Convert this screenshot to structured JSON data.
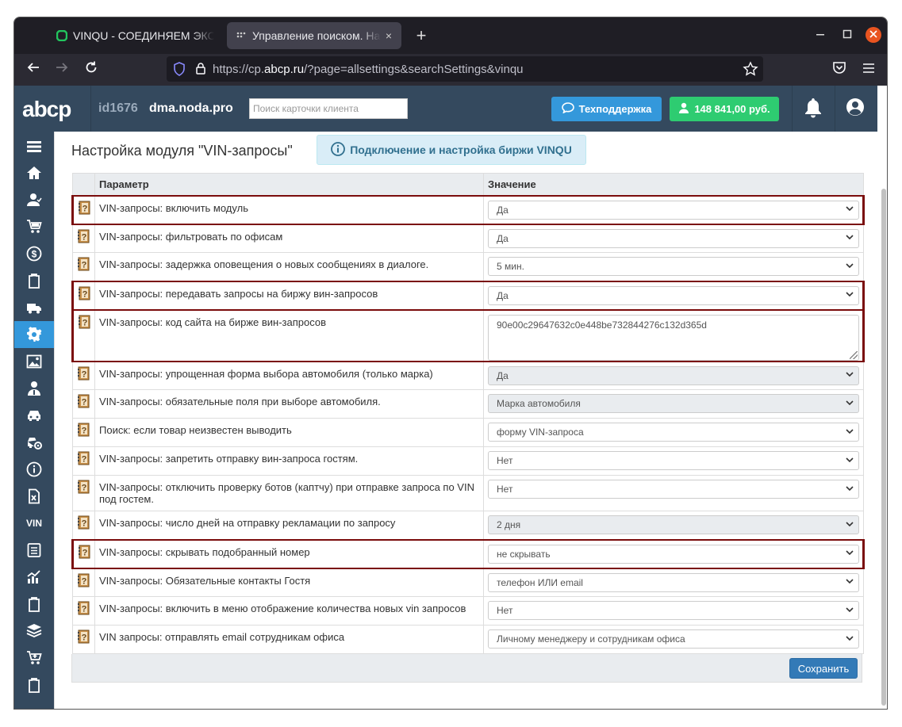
{
  "browser": {
    "tabs": [
      {
        "title": "VINQU - СОЕДИНЯЕМ ЭКСПЕРТОВ",
        "close": "×"
      },
      {
        "title": "Управление поиском. Настройки",
        "close": "×"
      }
    ],
    "new_tab": "+",
    "url_prefix": "https://cp.",
    "url_domain": "abcp.ru",
    "url_path": "/?page=allsettings&searchSettings&vinqu"
  },
  "topbar": {
    "logo": "abcp",
    "user_id": "id1676",
    "domain": "dma.noda.pro",
    "search_placeholder": "Поиск карточки клиента",
    "support_label": "Техподдержка",
    "balance_label": "148 841,00 руб."
  },
  "sidebar": {
    "vin_label": "VIN"
  },
  "page": {
    "title": "Настройка модуля \"VIN-запросы\"",
    "info_button": "Подключение и настройка биржи VINQU",
    "col_param": "Параметр",
    "col_value": "Значение",
    "save_button": "Сохранить"
  },
  "rows": [
    {
      "label": "VIN-запросы: включить модуль",
      "value": "Да",
      "type": "select",
      "disabled": false,
      "highlight": true
    },
    {
      "label": "VIN-запросы: фильтровать по офисам",
      "value": "Да",
      "type": "select",
      "disabled": false,
      "highlight": false
    },
    {
      "label": "VIN-запросы: задержка оповещения о новых сообщениях в диалоге.",
      "value": "5 мин.",
      "type": "select",
      "disabled": false,
      "highlight": false
    },
    {
      "label": "VIN-запросы: передавать запросы на биржу вин-запросов",
      "value": "Да",
      "type": "select",
      "disabled": false,
      "highlight": true
    },
    {
      "label": "VIN-запросы: код сайта на бирже вин-запросов",
      "value": "90e00c29647632c0e448be732844276c132d365d",
      "type": "textarea",
      "disabled": false,
      "highlight": true
    },
    {
      "label": "VIN-запросы: упрощенная форма выбора автомобиля (только марка)",
      "value": "Да",
      "type": "select",
      "disabled": true,
      "highlight": false
    },
    {
      "label": "VIN-запросы: обязательные поля при выборе автомобиля.",
      "value": "Марка автомобиля",
      "type": "select",
      "disabled": true,
      "highlight": false
    },
    {
      "label": "Поиск: если товар неизвестен выводить",
      "value": "форму VIN-запроса",
      "type": "select",
      "disabled": false,
      "highlight": false
    },
    {
      "label": "VIN-запросы: запретить отправку вин-запроса гостям.",
      "value": "Нет",
      "type": "select",
      "disabled": false,
      "highlight": false
    },
    {
      "label": "VIN-запросы: отключить проверку ботов (каптчу) при отправке запроса по VIN под гостем.",
      "value": "Нет",
      "type": "select",
      "disabled": false,
      "highlight": false
    },
    {
      "label": "VIN-запросы: число дней на отправку рекламации по запросу",
      "value": "2 дня",
      "type": "select",
      "disabled": true,
      "highlight": false
    },
    {
      "label": "VIN-запросы: скрывать подобранный номер",
      "value": "не скрывать",
      "type": "select",
      "disabled": false,
      "highlight": true
    },
    {
      "label": "VIN-запросы: Обязательные контакты Гостя",
      "value": "телефон ИЛИ email",
      "type": "select",
      "disabled": false,
      "highlight": false
    },
    {
      "label": "VIN-запросы: включить в меню отображение количества новых vin запросов",
      "value": "Нет",
      "type": "select",
      "disabled": false,
      "highlight": false
    },
    {
      "label": "VIN запросы: отправлять email сотрудникам офиса",
      "value": "Личному менеджеру и сотрудникам офиса",
      "type": "select",
      "disabled": false,
      "highlight": false
    }
  ],
  "colors": {
    "topbar": "#34495e",
    "active_nav": "#3498db",
    "support": "#3498db",
    "balance": "#2ecc71",
    "highlight_border": "#7a0b0b",
    "save": "#337ab7"
  }
}
